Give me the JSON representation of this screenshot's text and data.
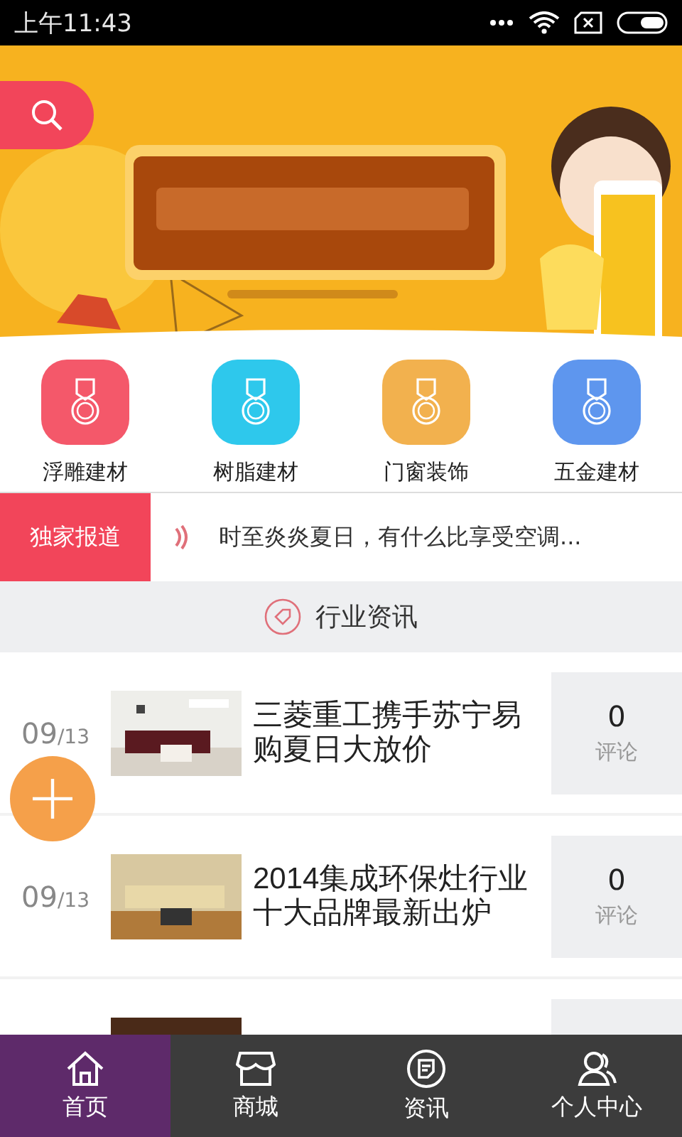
{
  "status_bar": {
    "time": "上午11:43"
  },
  "banner": {
    "kind": "picture"
  },
  "categories": [
    {
      "label": "浮雕建材",
      "color": "#f4586a"
    },
    {
      "label": "树脂建材",
      "color": "#2ec8ec"
    },
    {
      "label": "门窗装饰",
      "color": "#f2b14e"
    },
    {
      "label": "五金建材",
      "color": "#5e96ee"
    }
  ],
  "ticker": {
    "label": "独家报道",
    "text": "时至炎炎夏日，有什么比享受空调..."
  },
  "section": {
    "title": "行业资讯"
  },
  "news": [
    {
      "date": "09$_{/13}$",
      "thumb": {
        "kind": "picture"
      },
      "title": "三菱重工携手苏宁易购夏日大放价",
      "count": "0",
      "count_label": "评论"
    },
    {
      "date": "09$_{/13}$",
      "thumb": {
        "kind": "picture"
      },
      "title": "2014集成环保灶行业十大品牌最新出炉",
      "count": "0",
      "count_label": "评论"
    },
    {
      "thumb": {
        "kind": "picture"
      }
    }
  ],
  "nav": [
    {
      "label": "首页",
      "selected": true
    },
    {
      "label": "商城",
      "selected": false
    },
    {
      "label": "资讯",
      "selected": false
    },
    {
      "label": "个人中心",
      "selected": false
    }
  ]
}
